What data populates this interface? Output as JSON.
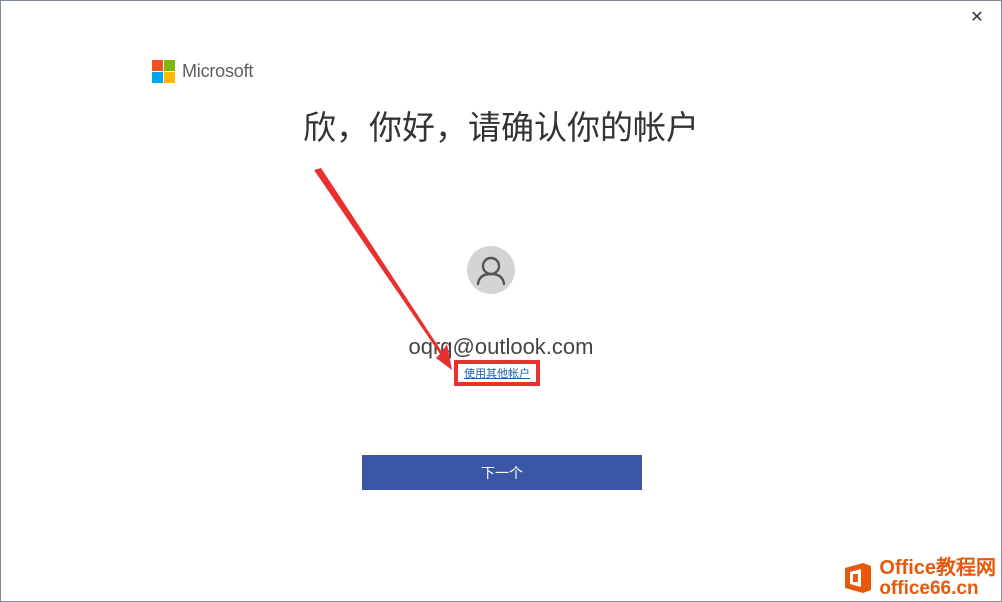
{
  "window": {
    "close_symbol": "✕"
  },
  "brand": {
    "name": "Microsoft",
    "logo_colors": [
      "#f25022",
      "#7fba00",
      "#00a4ef",
      "#ffb900"
    ]
  },
  "headline": "欣，你好，请确认你的帐户",
  "account": {
    "avatar_icon": "person-icon",
    "email": "oqrq@outlook.com",
    "switch_link": "使用其他帐户"
  },
  "actions": {
    "next_label": "下一个"
  },
  "annotation": {
    "color": "#e8302f"
  },
  "watermark": {
    "line1": "Office教程网",
    "line2": "office66.cn"
  },
  "colors": {
    "primary_button": "#3b56a4",
    "link": "#1f5ea8",
    "avatar_bg": "#d4d4d4"
  }
}
